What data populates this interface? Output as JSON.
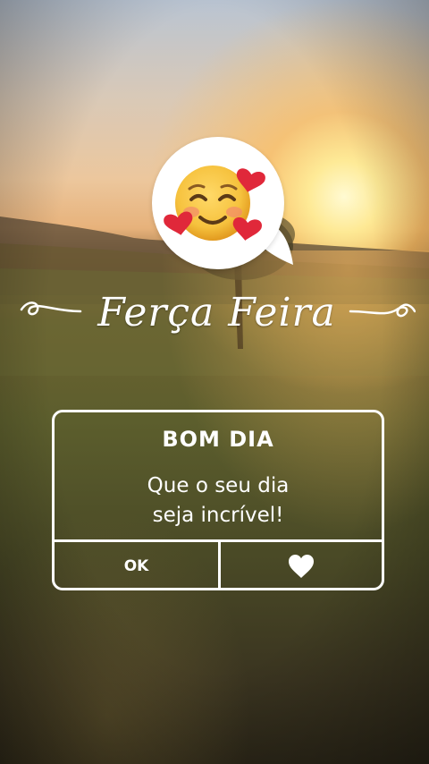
{
  "background": {
    "description_colors": {
      "sky_top": "#b9c4d2",
      "sun": "#fff6d0",
      "field": "#5c5e2d"
    }
  },
  "emoji": {
    "icon": "smiling-face-with-hearts-icon"
  },
  "title": {
    "text": "Ferça Feira"
  },
  "card": {
    "heading": "BOM DIA",
    "message_line1": "Que o seu dia",
    "message_line2": "seja incrível!",
    "ok_label": "OK",
    "like_icon": "heart-icon"
  },
  "colors": {
    "text": "#ffffff",
    "emoji_face": "#f6c23e",
    "heart": "#e0283a"
  }
}
